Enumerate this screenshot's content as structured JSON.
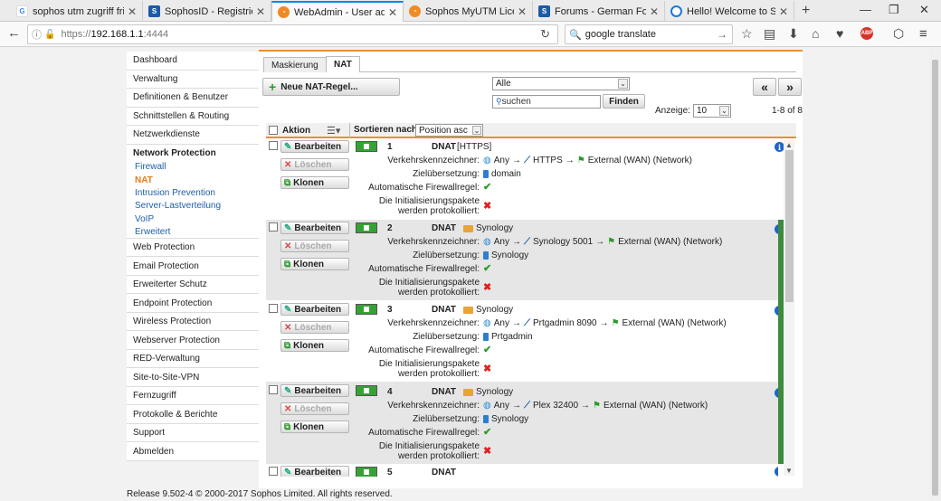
{
  "browser": {
    "tabs": [
      {
        "title": "sophos utm zugriff fritzb",
        "favicon": "google-icon"
      },
      {
        "title": "SophosID - Registrieren",
        "favicon": "sophos-icon"
      },
      {
        "title": "WebAdmin - User admin",
        "favicon": "webadmin-icon",
        "active": true
      },
      {
        "title": "Sophos MyUTM Licensin",
        "favicon": "webadmin-icon"
      },
      {
        "title": "Forums - German Forum",
        "favicon": "sophos-icon"
      },
      {
        "title": "Hello! Welcome to Syno",
        "favicon": "synology-icon"
      }
    ],
    "url_scheme": "https://",
    "url_host": "192.168.1.1",
    "url_port": ":4444",
    "search_value": "google translate"
  },
  "sidebar": {
    "items": [
      {
        "label": "Dashboard"
      },
      {
        "label": "Verwaltung"
      },
      {
        "label": "Definitionen & Benutzer"
      },
      {
        "label": "Schnittstellen & Routing"
      },
      {
        "label": "Netzwerkdienste"
      }
    ],
    "section": "Network Protection",
    "subitems": [
      {
        "label": "Firewall"
      },
      {
        "label": "NAT",
        "active": true
      },
      {
        "label": "Intrusion Prevention"
      },
      {
        "label": "Server-Lastverteilung"
      },
      {
        "label": "VoIP"
      },
      {
        "label": "Erweitert"
      }
    ],
    "items2": [
      {
        "label": "Web Protection"
      },
      {
        "label": "Email Protection"
      },
      {
        "label": "Erweiterter Schutz"
      },
      {
        "label": "Endpoint Protection"
      },
      {
        "label": "Wireless Protection"
      },
      {
        "label": "Webserver Protection"
      },
      {
        "label": "RED-Verwaltung"
      },
      {
        "label": "Site-to-Site-VPN"
      },
      {
        "label": "Fernzugriff"
      },
      {
        "label": "Protokolle & Berichte"
      },
      {
        "label": "Support"
      },
      {
        "label": "Abmelden"
      }
    ]
  },
  "tabs": {
    "masq": "Maskierung",
    "nat": "NAT"
  },
  "toolbar": {
    "new_rule": "Neue NAT-Regel...",
    "filter_value": "Alle",
    "search_placeholder": "suchen",
    "find": "Finden",
    "display_label": "Anzeige:",
    "display_value": "10",
    "page_first": "«",
    "page_next": "»",
    "range": "1-8 of 8"
  },
  "table": {
    "col_action": "Aktion",
    "sort_label": "Sortieren nach:",
    "sort_value": "Position asc"
  },
  "row_labels": {
    "edit": "Bearbeiten",
    "delete": "Löschen",
    "clone": "Klonen",
    "traffic": "Verkehrskennzeichner:",
    "dest": "Zielübersetzung:",
    "auto_fw": "Automatische Firewallregel:",
    "log1": "Die Initialisierungspakete",
    "log2": "werden protokolliert:"
  },
  "rules": [
    {
      "num": "1",
      "type": "DNAT",
      "name": "[HTTPS]",
      "source": "Any",
      "service": "HTTPS",
      "iface": "External (WAN) (Network)",
      "target": "domain",
      "auto_fw": true,
      "logged": false
    },
    {
      "num": "2",
      "type": "DNAT",
      "name": "Synology",
      "source": "Any",
      "service": "Synology 5001",
      "iface": "External (WAN) (Network)",
      "target": "Synology",
      "auto_fw": true,
      "logged": false
    },
    {
      "num": "3",
      "type": "DNAT",
      "name": "Synology",
      "source": "Any",
      "service": "Prtgadmin 8090",
      "iface": "External (WAN) (Network)",
      "target": "Prtgadmin",
      "auto_fw": true,
      "logged": false
    },
    {
      "num": "4",
      "type": "DNAT",
      "name": "Synology",
      "source": "Any",
      "service": "Plex 32400",
      "iface": "External (WAN) (Network)",
      "target": "Synology",
      "auto_fw": true,
      "logged": false
    },
    {
      "num": "5",
      "type": "DNAT",
      "name": ""
    }
  ],
  "footer": "Release 9.502-4 © 2000-2017 Sophos Limited. All rights reserved.",
  "colors": {
    "accent": "#e8912c",
    "link": "#1d5fa8",
    "active_nav": "#e57c1a",
    "enabled": "#3e8a3e"
  }
}
